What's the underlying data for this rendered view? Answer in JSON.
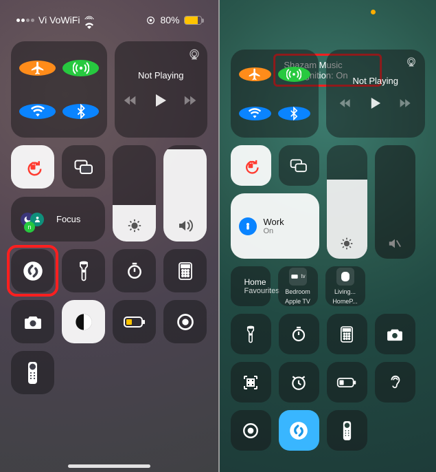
{
  "left": {
    "status": {
      "carrier": "Vi VoWiFi",
      "battery_text": "80%"
    },
    "media": {
      "title": "Not Playing"
    },
    "focus": {
      "label": "Focus"
    },
    "brightness_pct": 38,
    "volume_pct": 96
  },
  "right": {
    "banner": "Shazam Music Recognition: On",
    "media": {
      "title": "Not Playing"
    },
    "focus": {
      "label": "Work",
      "sub": "On"
    },
    "brightness_pct": 70,
    "home": {
      "label": "Home",
      "sub": "Favourites",
      "bedroom": {
        "l1": "Bedroom",
        "l2": "Apple TV"
      },
      "living": {
        "l1": "Living...",
        "l2": "HomeP..."
      }
    }
  }
}
